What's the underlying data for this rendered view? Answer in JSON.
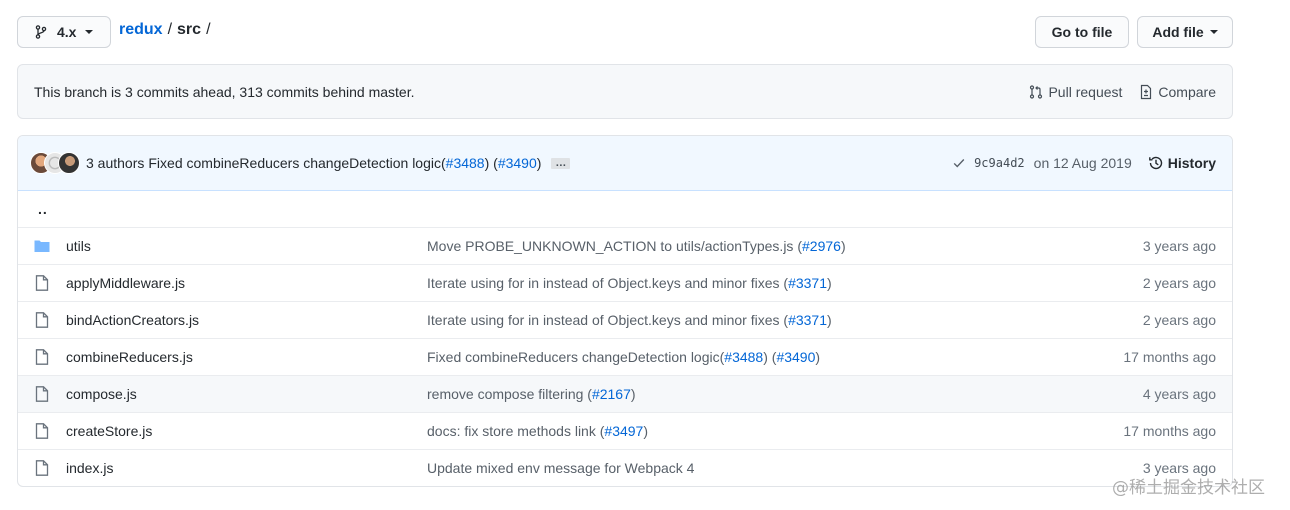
{
  "header": {
    "branch": "4.x",
    "breadcrumb": {
      "repo": "redux",
      "sep1": "/",
      "dir": "src",
      "sep2": "/"
    },
    "goto_label": "Go to file",
    "add_label": "Add file"
  },
  "branch_info": {
    "message": "This branch is 3 commits ahead, 313 commits behind master.",
    "pull_request_label": "Pull request",
    "compare_label": "Compare"
  },
  "latest_commit": {
    "authors": "3 authors",
    "message_prefix": "Fixed combineReducers changeDetection logic(",
    "pr1": "#3488",
    "middle": ") (",
    "pr2": "#3490",
    "suffix": ")",
    "ellipsis": "…",
    "sha": "9c9a4d2",
    "date": "on 12 Aug 2019",
    "history_label": "History"
  },
  "updir": "..",
  "files": [
    {
      "name": "utils",
      "type": "dir",
      "msg_pre": "Move PROBE_UNKNOWN_ACTION to utils/actionTypes.js (",
      "pr": "#2976",
      "msg_post": ")",
      "age": "3 years ago"
    },
    {
      "name": "applyMiddleware.js",
      "type": "file",
      "msg_pre": "Iterate using for in instead of Object.keys and minor fixes (",
      "pr": "#3371",
      "msg_post": ")",
      "age": "2 years ago"
    },
    {
      "name": "bindActionCreators.js",
      "type": "file",
      "msg_pre": "Iterate using for in instead of Object.keys and minor fixes (",
      "pr": "#3371",
      "msg_post": ")",
      "age": "2 years ago"
    },
    {
      "name": "combineReducers.js",
      "type": "file",
      "msg_pre": "Fixed combineReducers changeDetection logic(",
      "pr": "#3488",
      "msg_mid": ") (",
      "pr2": "#3490",
      "msg_post": ")",
      "age": "17 months ago"
    },
    {
      "name": "compose.js",
      "type": "file",
      "msg_pre": "remove compose filtering (",
      "pr": "#2167",
      "msg_post": ")",
      "age": "4 years ago"
    },
    {
      "name": "createStore.js",
      "type": "file",
      "msg_pre": "docs: fix store methods link (",
      "pr": "#3497",
      "msg_post": ")",
      "age": "17 months ago"
    },
    {
      "name": "index.js",
      "type": "file",
      "msg_pre": "Update mixed env message for Webpack 4",
      "pr": "",
      "msg_post": "",
      "age": "3 years ago"
    }
  ],
  "watermark": "@稀土掘金技术社区",
  "colors": {
    "link": "#0366d6",
    "folder": "#79b8ff",
    "commit_bar_bg": "#f1f8ff",
    "check": "#586069"
  }
}
